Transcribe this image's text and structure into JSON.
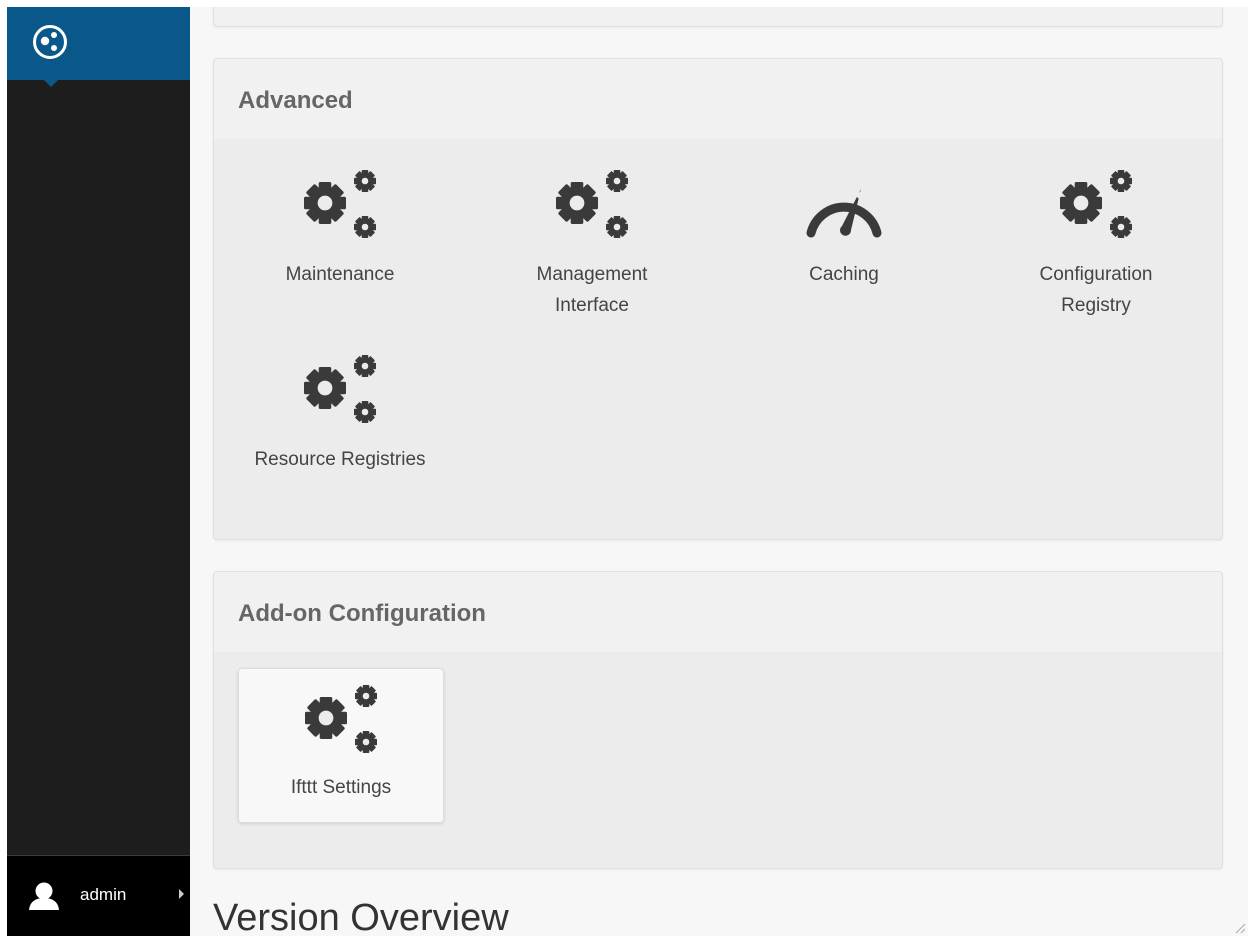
{
  "toolbar": {
    "logo_icon": "plone-logo-icon",
    "user": {
      "name": "admin",
      "icon": "user-icon"
    }
  },
  "advanced": {
    "title": "Advanced",
    "items": [
      {
        "label": "Maintenance",
        "icon": "gears-icon"
      },
      {
        "label": "Management\nInterface",
        "icon": "gears-icon"
      },
      {
        "label": "Caching",
        "icon": "dashboard-icon"
      },
      {
        "label": "Configuration\nRegistry",
        "icon": "gears-icon"
      },
      {
        "label": "Resource Registries",
        "icon": "gears-icon"
      }
    ]
  },
  "addon": {
    "title": "Add-on Configuration",
    "items": [
      {
        "label": "Ifttt Settings",
        "icon": "gears-icon"
      }
    ]
  },
  "version": {
    "title": "Version Overview"
  },
  "colors": {
    "toolbar_bg": "#1d1d1d",
    "logo_bg": "#0a5889",
    "panel_bg": "#ececec",
    "panel_header_bg": "#f1f1f1",
    "icon": "#3a3a3a"
  }
}
